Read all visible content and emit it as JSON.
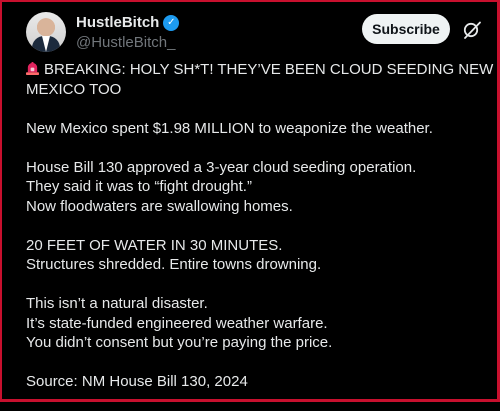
{
  "author": {
    "display_name": "HustleBitch",
    "handle": "@HustleBitch_",
    "verified": true
  },
  "actions": {
    "subscribe_label": "Subscribe",
    "grok_icon": "grok-icon"
  },
  "tweet": {
    "paragraphs": [
      [
        "BREAKING: HOLY SH*T!  THEY’VE BEEN CLOUD SEEDING NEW",
        "MEXICO TOO"
      ],
      [
        "New Mexico spent $1.98 MILLION to weaponize the weather."
      ],
      [
        "House Bill 130 approved a 3-year cloud seeding operation.",
        "They said it was to “fight drought.”",
        "Now floodwaters are swallowing homes."
      ],
      [
        "20 FEET OF WATER IN 30 MINUTES.",
        "Structures shredded. Entire towns drowning."
      ],
      [
        "This isn’t a natural disaster.",
        "It’s state-funded engineered weather warfare.",
        "You didn’t consent but you’re paying the price."
      ],
      [
        "Source: NM House Bill 130, 2024"
      ]
    ]
  },
  "colors": {
    "background": "#000000",
    "text": "#e7e9ea",
    "secondary_text": "#71767b",
    "verified_blue": "#1d9bf0",
    "frame_red": "#c8102e",
    "siren_red": "#e0245e"
  }
}
